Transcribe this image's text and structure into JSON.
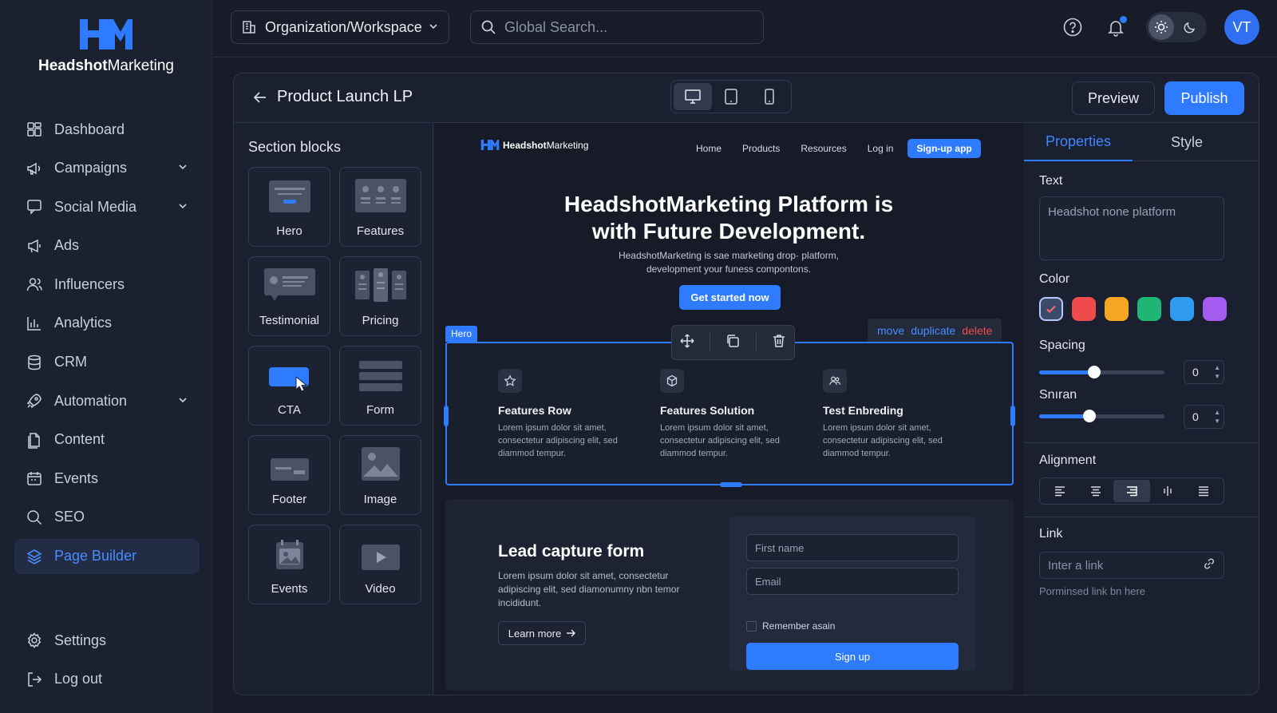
{
  "brand": {
    "name_bold": "Headshot",
    "name_rest": "Marketing"
  },
  "sidebar": {
    "items": [
      {
        "label": "Dashboard",
        "icon": "dashboard-icon",
        "chevron": false,
        "active": false
      },
      {
        "label": "Campaigns",
        "icon": "megaphone-icon",
        "chevron": true,
        "active": false
      },
      {
        "label": "Social Media",
        "icon": "chat-icon",
        "chevron": true,
        "active": false
      },
      {
        "label": "Ads",
        "icon": "loudspeaker-icon",
        "chevron": false,
        "active": false
      },
      {
        "label": "Influencers",
        "icon": "users-icon",
        "chevron": false,
        "active": false
      },
      {
        "label": "Analytics",
        "icon": "bar-chart-icon",
        "chevron": false,
        "active": false
      },
      {
        "label": "CRM",
        "icon": "database-icon",
        "chevron": false,
        "active": false
      },
      {
        "label": "Automation",
        "icon": "rocket-icon",
        "chevron": true,
        "active": false
      },
      {
        "label": "Content",
        "icon": "document-icon",
        "chevron": false,
        "active": false
      },
      {
        "label": "Events",
        "icon": "calendar-icon",
        "chevron": false,
        "active": false
      },
      {
        "label": "SEO",
        "icon": "search-icon",
        "chevron": false,
        "active": false
      },
      {
        "label": "Page Builder",
        "icon": "layers-icon",
        "chevron": false,
        "active": true
      }
    ],
    "bottom": [
      {
        "label": "Settings",
        "icon": "gear-icon"
      },
      {
        "label": "Log out",
        "icon": "logout-icon"
      }
    ]
  },
  "topbar": {
    "workspace": "Organization/Workspace",
    "search_placeholder": "Global Search...",
    "avatar": "VT"
  },
  "editor": {
    "title": "Product Launch LP",
    "preview": "Preview",
    "publish": "Publish"
  },
  "blocks": {
    "title": "Section blocks",
    "items": [
      "Hero",
      "Features",
      "Testimonial",
      "Pricing",
      "CTA",
      "Form",
      "Footer",
      "Image",
      "Events",
      "Video"
    ]
  },
  "canvas": {
    "site_brand_bold": "Headshot",
    "site_brand_rest": "Marketing",
    "nav_links": [
      "Home",
      "Products",
      "Resources",
      "Log in"
    ],
    "nav_cta": "Sign-up app",
    "hero_title_1": "HeadshotMarketing Platform is",
    "hero_title_2": "with Future Development.",
    "hero_sub_1": "HeadshotMarketing is sae marketing drop· platform,",
    "hero_sub_2": "development your funess compontons.",
    "hero_btn": "Get started now",
    "section_tag": "Hero",
    "actions": {
      "move": "move",
      "duplicate": "duplicate",
      "delete": "delete"
    },
    "features": [
      {
        "title": "Features Row",
        "text": "Lorem ipsum dolor sit amet, consectetur adipiscing elit, sed diammod tempur.",
        "icon": "star-icon"
      },
      {
        "title": "Features Solution",
        "text": "Lorem ipsum dolor sit amet, consectetur adipiscing elit, sed diammod tempur.",
        "icon": "cube-icon"
      },
      {
        "title": "Test Enbreding",
        "text": "Lorem ipsum dolor sit amet, consectetur adipiscing elit, sed diammod tempur.",
        "icon": "people-icon"
      }
    ],
    "lead": {
      "title": "Lead capture form",
      "text": "Lorem ipsum dolor sit amet, consectetur adipiscing elit, sed diamonumny nbn temor incididunt.",
      "learn": "Learn more",
      "first_name": "First name",
      "email": "Email",
      "remember": "Remember asain",
      "signup": "Sign up"
    }
  },
  "props": {
    "tab_properties": "Properties",
    "tab_style": "Style",
    "text_label": "Text",
    "text_value": "Headshot none platform",
    "color_label": "Color",
    "colors": [
      "#3b4a6b",
      "#ef4b4b",
      "#f5a623",
      "#1fb574",
      "#2f9bf0",
      "#a45cf0"
    ],
    "spacing_label": "Spacing",
    "spacing_value": "0",
    "spacing_level": 0.44,
    "second_label": "Snıran",
    "second_value": "0",
    "second_level": 0.4,
    "alignment_label": "Alignment",
    "link_label": "Link",
    "link_placeholder": "Inter a link",
    "link_hint": "Porminsed link bn here"
  },
  "accent": "#2f7bff"
}
